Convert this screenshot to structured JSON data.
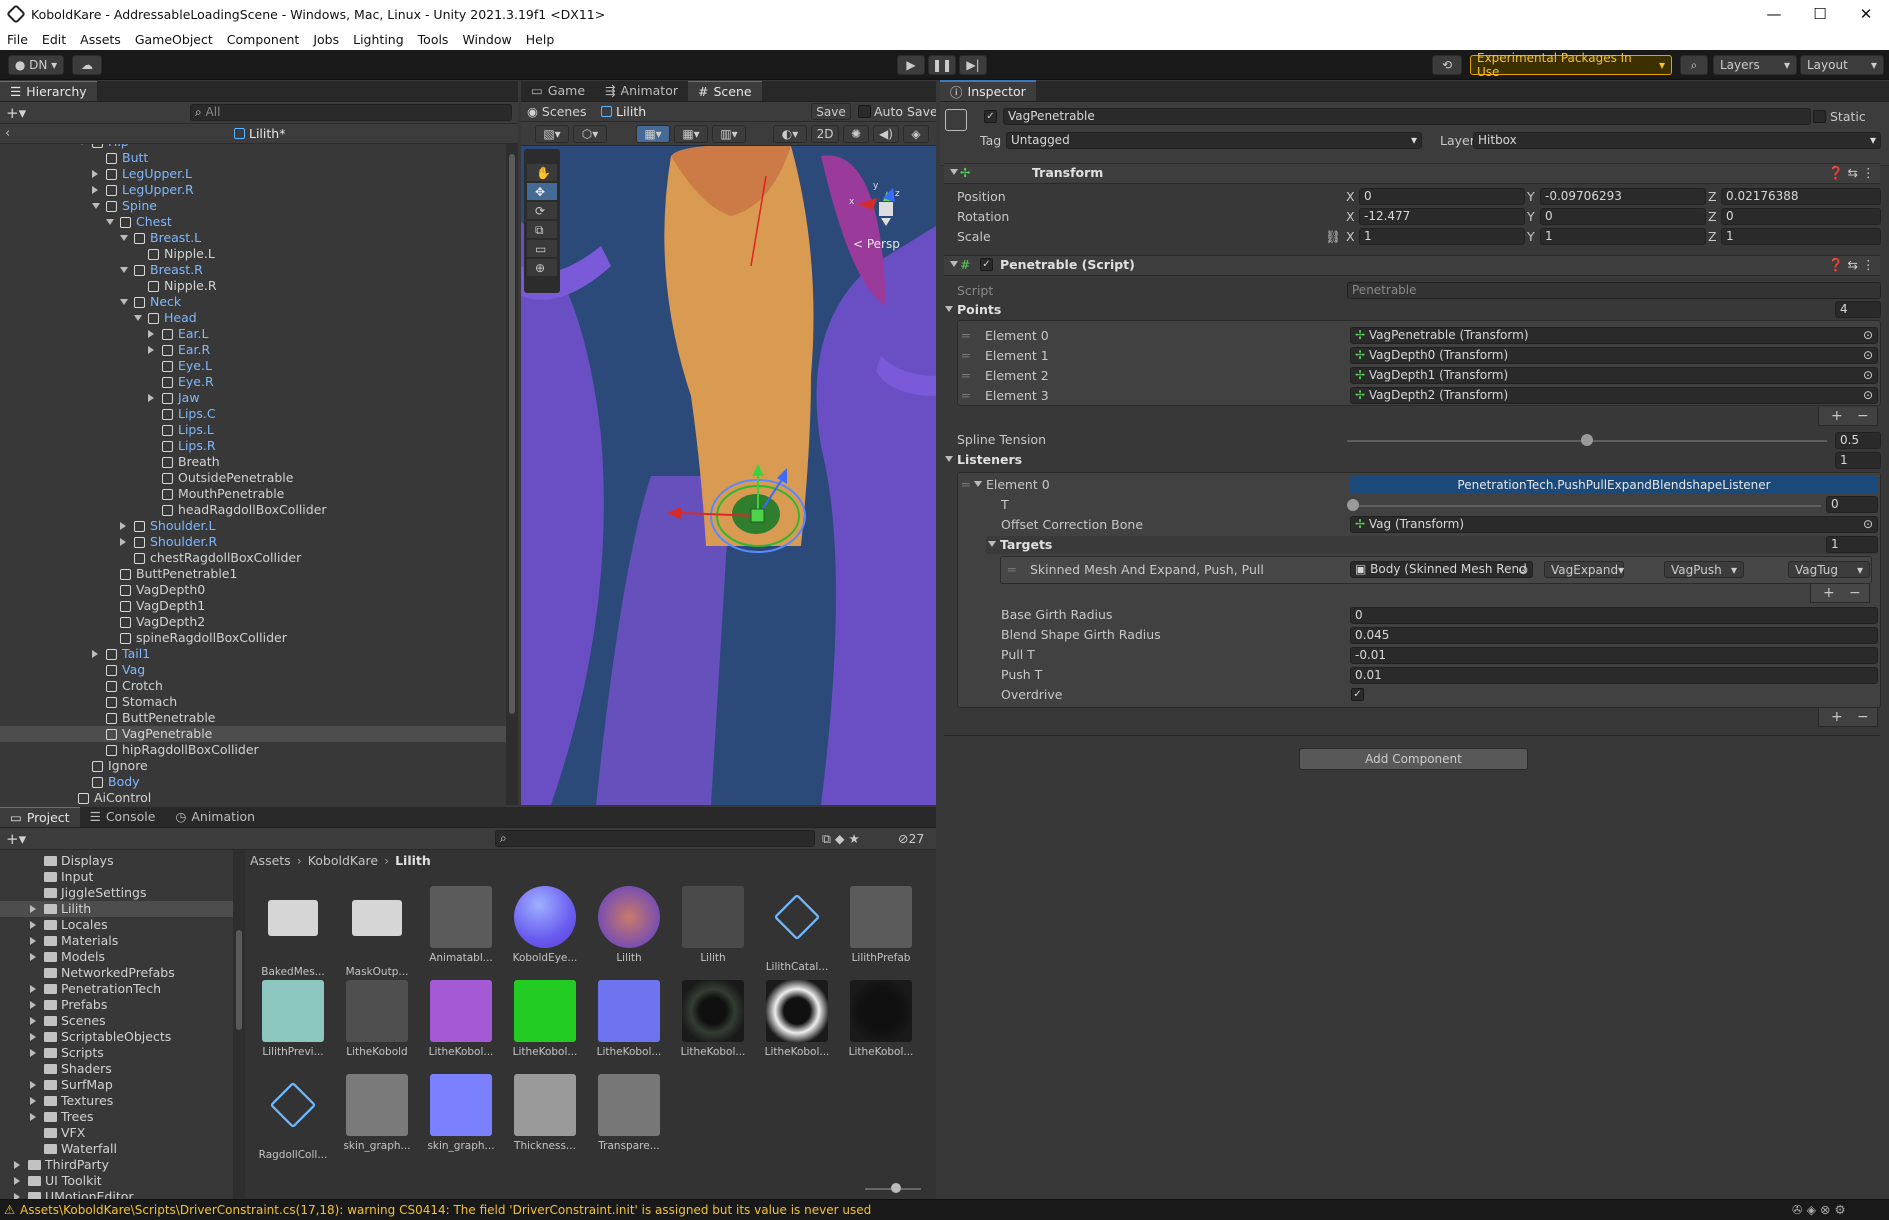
{
  "window": {
    "title": "KoboldKare - AddressableLoadingScene - Windows, Mac, Linux - Unity 2021.3.19f1 <DX11>"
  },
  "menu": [
    "File",
    "Edit",
    "Assets",
    "GameObject",
    "Component",
    "Jobs",
    "Lighting",
    "Tools",
    "Window",
    "Help"
  ],
  "toolbar": {
    "account": "DN",
    "experimental": "Experimental Packages In Use",
    "layers": "Layers",
    "layout": "Layout"
  },
  "hierarchy": {
    "tab": "Hierarchy",
    "search_placeholder": "All",
    "scene": "Lilith*",
    "rows": [
      {
        "label": "Hip",
        "depth": 3,
        "arrow": "down",
        "blue": true
      },
      {
        "label": "Butt",
        "depth": 4,
        "arrow": "none",
        "blue": true
      },
      {
        "label": "LegUpper.L",
        "depth": 4,
        "arrow": "right",
        "blue": true
      },
      {
        "label": "LegUpper.R",
        "depth": 4,
        "arrow": "right",
        "blue": true
      },
      {
        "label": "Spine",
        "depth": 4,
        "arrow": "down",
        "blue": true
      },
      {
        "label": "Chest",
        "depth": 5,
        "arrow": "down",
        "blue": true
      },
      {
        "label": "Breast.L",
        "depth": 6,
        "arrow": "down",
        "blue": true
      },
      {
        "label": "Nipple.L",
        "depth": 7,
        "arrow": "none",
        "blue": false
      },
      {
        "label": "Breast.R",
        "depth": 6,
        "arrow": "down",
        "blue": true
      },
      {
        "label": "Nipple.R",
        "depth": 7,
        "arrow": "none",
        "blue": false
      },
      {
        "label": "Neck",
        "depth": 6,
        "arrow": "down",
        "blue": true
      },
      {
        "label": "Head",
        "depth": 7,
        "arrow": "down",
        "blue": true
      },
      {
        "label": "Ear.L",
        "depth": 8,
        "arrow": "right",
        "blue": true
      },
      {
        "label": "Ear.R",
        "depth": 8,
        "arrow": "right",
        "blue": true
      },
      {
        "label": "Eye.L",
        "depth": 8,
        "arrow": "none",
        "blue": true
      },
      {
        "label": "Eye.R",
        "depth": 8,
        "arrow": "none",
        "blue": true
      },
      {
        "label": "Jaw",
        "depth": 8,
        "arrow": "right",
        "blue": true
      },
      {
        "label": "Lips.C",
        "depth": 8,
        "arrow": "none",
        "blue": true
      },
      {
        "label": "Lips.L",
        "depth": 8,
        "arrow": "none",
        "blue": true
      },
      {
        "label": "Lips.R",
        "depth": 8,
        "arrow": "none",
        "blue": true
      },
      {
        "label": "Breath",
        "depth": 8,
        "arrow": "none",
        "blue": false
      },
      {
        "label": "OutsidePenetrable",
        "depth": 8,
        "arrow": "none",
        "blue": false
      },
      {
        "label": "MouthPenetrable",
        "depth": 8,
        "arrow": "none",
        "blue": false
      },
      {
        "label": "headRagdollBoxCollider",
        "depth": 8,
        "arrow": "none",
        "blue": false
      },
      {
        "label": "Shoulder.L",
        "depth": 6,
        "arrow": "right",
        "blue": true
      },
      {
        "label": "Shoulder.R",
        "depth": 6,
        "arrow": "right",
        "blue": true
      },
      {
        "label": "chestRagdollBoxCollider",
        "depth": 6,
        "arrow": "none",
        "blue": false
      },
      {
        "label": "ButtPenetrable1",
        "depth": 5,
        "arrow": "none",
        "blue": false
      },
      {
        "label": "VagDepth0",
        "depth": 5,
        "arrow": "none",
        "blue": false
      },
      {
        "label": "VagDepth1",
        "depth": 5,
        "arrow": "none",
        "blue": false
      },
      {
        "label": "VagDepth2",
        "depth": 5,
        "arrow": "none",
        "blue": false
      },
      {
        "label": "spineRagdollBoxCollider",
        "depth": 5,
        "arrow": "none",
        "blue": false
      },
      {
        "label": "Tail1",
        "depth": 4,
        "arrow": "right",
        "blue": true
      },
      {
        "label": "Vag",
        "depth": 4,
        "arrow": "none",
        "blue": true
      },
      {
        "label": "Crotch",
        "depth": 4,
        "arrow": "none",
        "blue": false
      },
      {
        "label": "Stomach",
        "depth": 4,
        "arrow": "none",
        "blue": false
      },
      {
        "label": "ButtPenetrable",
        "depth": 4,
        "arrow": "none",
        "blue": false
      },
      {
        "label": "VagPenetrable",
        "depth": 4,
        "arrow": "none",
        "blue": false,
        "selected": true
      },
      {
        "label": "hipRagdollBoxCollider",
        "depth": 4,
        "arrow": "none",
        "blue": false
      },
      {
        "label": "Ignore",
        "depth": 3,
        "arrow": "none",
        "blue": false
      },
      {
        "label": "Body",
        "depth": 3,
        "arrow": "none",
        "blue": true
      },
      {
        "label": "AiControl",
        "depth": 2,
        "arrow": "none",
        "blue": false
      }
    ]
  },
  "scene": {
    "tabs": [
      "Game",
      "Animator",
      "Scene"
    ],
    "active_tab": "Scene",
    "scenes_label": "Scenes",
    "object": "Lilith",
    "save": "Save",
    "autosave": "Auto Save",
    "mode_2d": "2D",
    "persp": "< Persp",
    "gizmo_x": "x",
    "gizmo_y": "y",
    "gizmo_z": "z"
  },
  "inspector": {
    "tab": "Inspector",
    "object_name": "VagPenetrable",
    "static": "Static",
    "tag_label": "Tag",
    "tag": "Untagged",
    "layer_label": "Layer",
    "layer": "Hitbox",
    "transform": {
      "title": "Transform",
      "position_label": "Position",
      "rotation_label": "Rotation",
      "scale_label": "Scale",
      "pos": [
        "0",
        "-0.09706293",
        "0.02176388"
      ],
      "rot": [
        "-12.477",
        "0",
        "0"
      ],
      "scale": [
        "1",
        "1",
        "1"
      ]
    },
    "penetrable": {
      "title": "Penetrable (Script)",
      "script_label": "Script",
      "script": "Penetrable",
      "points_label": "Points",
      "points_count": "4",
      "points": [
        {
          "label": "Element 0",
          "value": "VagPenetrable (Transform)"
        },
        {
          "label": "Element 1",
          "value": "VagDepth0 (Transform)"
        },
        {
          "label": "Element 2",
          "value": "VagDepth1 (Transform)"
        },
        {
          "label": "Element 3",
          "value": "VagDepth2 (Transform)"
        }
      ],
      "spline_label": "Spline Tension",
      "spline_value": "0.5",
      "spline_fraction": 0.5,
      "listeners_label": "Listeners",
      "listeners_count": "1",
      "listener_element": "Element 0",
      "listener_type": "PenetrationTech.PushPullExpandBlendshapeListener",
      "t_label": "T",
      "t_value": "0",
      "t_fraction": 0,
      "offset_label": "Offset Correction Bone",
      "offset_value": "Vag (Transform)",
      "targets_label": "Targets",
      "targets_count": "1",
      "target_label": "Skinned Mesh And Expand, Push, Pull",
      "target_mesh": "Body (Skinned Mesh Rend",
      "target_expand": "VagExpand",
      "target_push": "VagPush",
      "target_tug": "VagTug",
      "base_girth_label": "Base Girth Radius",
      "base_girth": "0",
      "blend_girth_label": "Blend Shape Girth Radius",
      "blend_girth": "0.045",
      "pull_label": "Pull T",
      "pull": "-0.01",
      "push_label": "Push T",
      "push": "0.01",
      "overdrive_label": "Overdrive"
    },
    "add_component": "Add Component"
  },
  "project": {
    "tabs": [
      "Project",
      "Console",
      "Animation"
    ],
    "hidden_count": "27",
    "breadcrumb": [
      "Assets",
      "KoboldKare",
      "Lilith"
    ],
    "folders": [
      {
        "label": "Displays",
        "arrow": false
      },
      {
        "label": "Input",
        "arrow": false
      },
      {
        "label": "JiggleSettings",
        "arrow": false
      },
      {
        "label": "Lilith",
        "arrow": true,
        "selected": true
      },
      {
        "label": "Locales",
        "arrow": true
      },
      {
        "label": "Materials",
        "arrow": true
      },
      {
        "label": "Models",
        "arrow": true
      },
      {
        "label": "NetworkedPrefabs",
        "arrow": false
      },
      {
        "label": "PenetrationTech",
        "arrow": true
      },
      {
        "label": "Prefabs",
        "arrow": true
      },
      {
        "label": "Scenes",
        "arrow": true
      },
      {
        "label": "ScriptableObjects",
        "arrow": true
      },
      {
        "label": "Scripts",
        "arrow": true
      },
      {
        "label": "Shaders",
        "arrow": false
      },
      {
        "label": "SurfMap",
        "arrow": true
      },
      {
        "label": "Textures",
        "arrow": true
      },
      {
        "label": "Trees",
        "arrow": true
      },
      {
        "label": "VFX",
        "arrow": false
      },
      {
        "label": "Waterfall",
        "arrow": false
      },
      {
        "label": "ThirdParty",
        "arrow": true,
        "root": true
      },
      {
        "label": "UI Toolkit",
        "arrow": true,
        "root": true
      },
      {
        "label": "UMotionEditor",
        "arrow": true,
        "root": true
      }
    ],
    "assets": [
      {
        "label": "BakedMes...",
        "color": "#d0d0d0"
      },
      {
        "label": "MaskOutp...",
        "color": "#d0d0d0"
      },
      {
        "label": "Animatabl...",
        "color": "#5b5b5b"
      },
      {
        "label": "KoboldEye...",
        "color": "#6f74f2"
      },
      {
        "label": "Lilith",
        "color": "#7a4fb0"
      },
      {
        "label": "Lilith",
        "color": "#4a4a4a"
      },
      {
        "label": "LilithCatal...",
        "color": "#333333"
      },
      {
        "label": "LilithPrefab",
        "color": "#5b5b5b"
      },
      {
        "label": "LilithPrevi...",
        "color": "#8cc8c0"
      },
      {
        "label": "LitheKobold",
        "color": "#4f4f4f"
      },
      {
        "label": "LitheKobol...",
        "color": "#a35ad4"
      },
      {
        "label": "LitheKobol...",
        "color": "#22cc22"
      },
      {
        "label": "LitheKobol...",
        "color": "#6e74ee"
      },
      {
        "label": "LitheKobol...",
        "color": "#333d33"
      },
      {
        "label": "LitheKobol...",
        "color": "#eeeeee"
      },
      {
        "label": "LitheKobol...",
        "color": "#111111"
      },
      {
        "label": "RagdollColl...",
        "color": "#333333"
      },
      {
        "label": "skin_graph...",
        "color": "#7a7a7a"
      },
      {
        "label": "skin_graph...",
        "color": "#7b80ff"
      },
      {
        "label": "Thickness...",
        "color": "#9a9a9a"
      },
      {
        "label": "Transpare...",
        "color": "#777777"
      }
    ]
  },
  "status": {
    "message": "Assets\\KoboldKare\\Scripts\\DriverConstraint.cs(17,18): warning CS0414: The field 'DriverConstraint.init' is assigned but its value is never used"
  }
}
